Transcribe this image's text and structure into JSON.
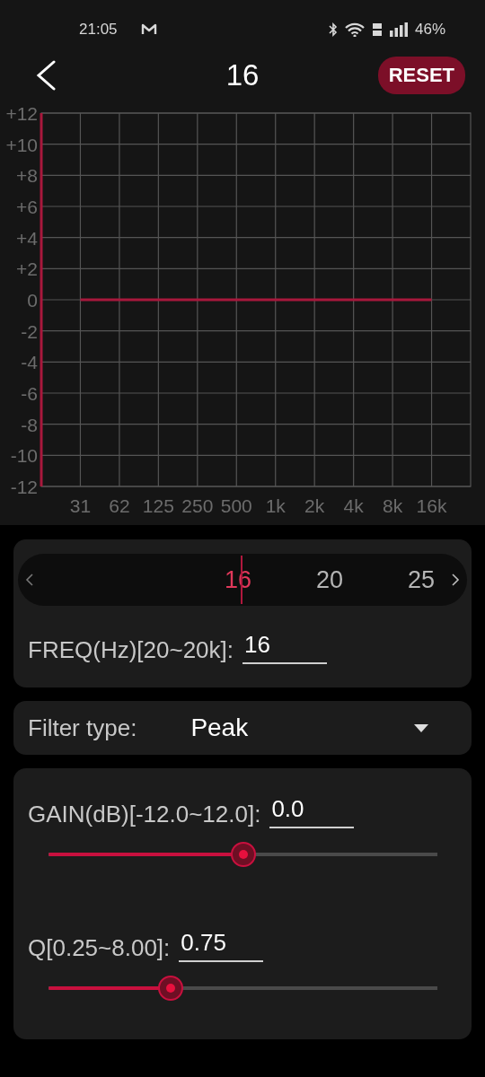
{
  "status_bar": {
    "time": "21:05",
    "battery": "46%"
  },
  "header": {
    "title": "16",
    "reset_button": "RESET"
  },
  "chart": {
    "chart_data": {
      "type": "line",
      "grid": true,
      "categories": [
        "31",
        "62",
        "125",
        "250",
        "500",
        "1k",
        "2k",
        "4k",
        "8k",
        "16k"
      ],
      "ylim": [
        -12,
        12
      ],
      "series": [
        {
          "color": "#a8183c",
          "values": [
            0,
            0,
            0,
            0,
            0,
            0,
            0,
            0,
            0,
            0
          ]
        }
      ],
      "yticks": [
        {
          "value": 12,
          "label": "+12"
        },
        {
          "value": 10,
          "label": "+10"
        },
        {
          "value": 8,
          "label": "+8"
        },
        {
          "value": 6,
          "label": "+6"
        },
        {
          "value": 4,
          "label": "+4"
        },
        {
          "value": 2,
          "label": "+2"
        },
        {
          "value": 0,
          "label": "0"
        },
        {
          "value": -2,
          "label": "-2"
        },
        {
          "value": -4,
          "label": "-4"
        },
        {
          "value": -6,
          "label": "-6"
        },
        {
          "value": -8,
          "label": "-8"
        },
        {
          "value": -10,
          "label": "-10"
        },
        {
          "value": -12,
          "label": "-12"
        }
      ]
    }
  },
  "frequency_picker": {
    "items": [
      {
        "label": "16",
        "selected": true
      },
      {
        "label": "20",
        "selected": false
      },
      {
        "label": "25",
        "selected": false
      }
    ]
  },
  "freq_field": {
    "label": "FREQ(Hz)[20~20k]:",
    "value": "16"
  },
  "filter": {
    "label": "Filter type:",
    "value": "Peak"
  },
  "params": [
    {
      "label": "GAIN(dB)[-12.0~12.0]:",
      "value": "0.0",
      "level": 0.5
    },
    {
      "label": "Q[0.25~8.00]:",
      "value": "0.75",
      "level": 0.315
    }
  ]
}
